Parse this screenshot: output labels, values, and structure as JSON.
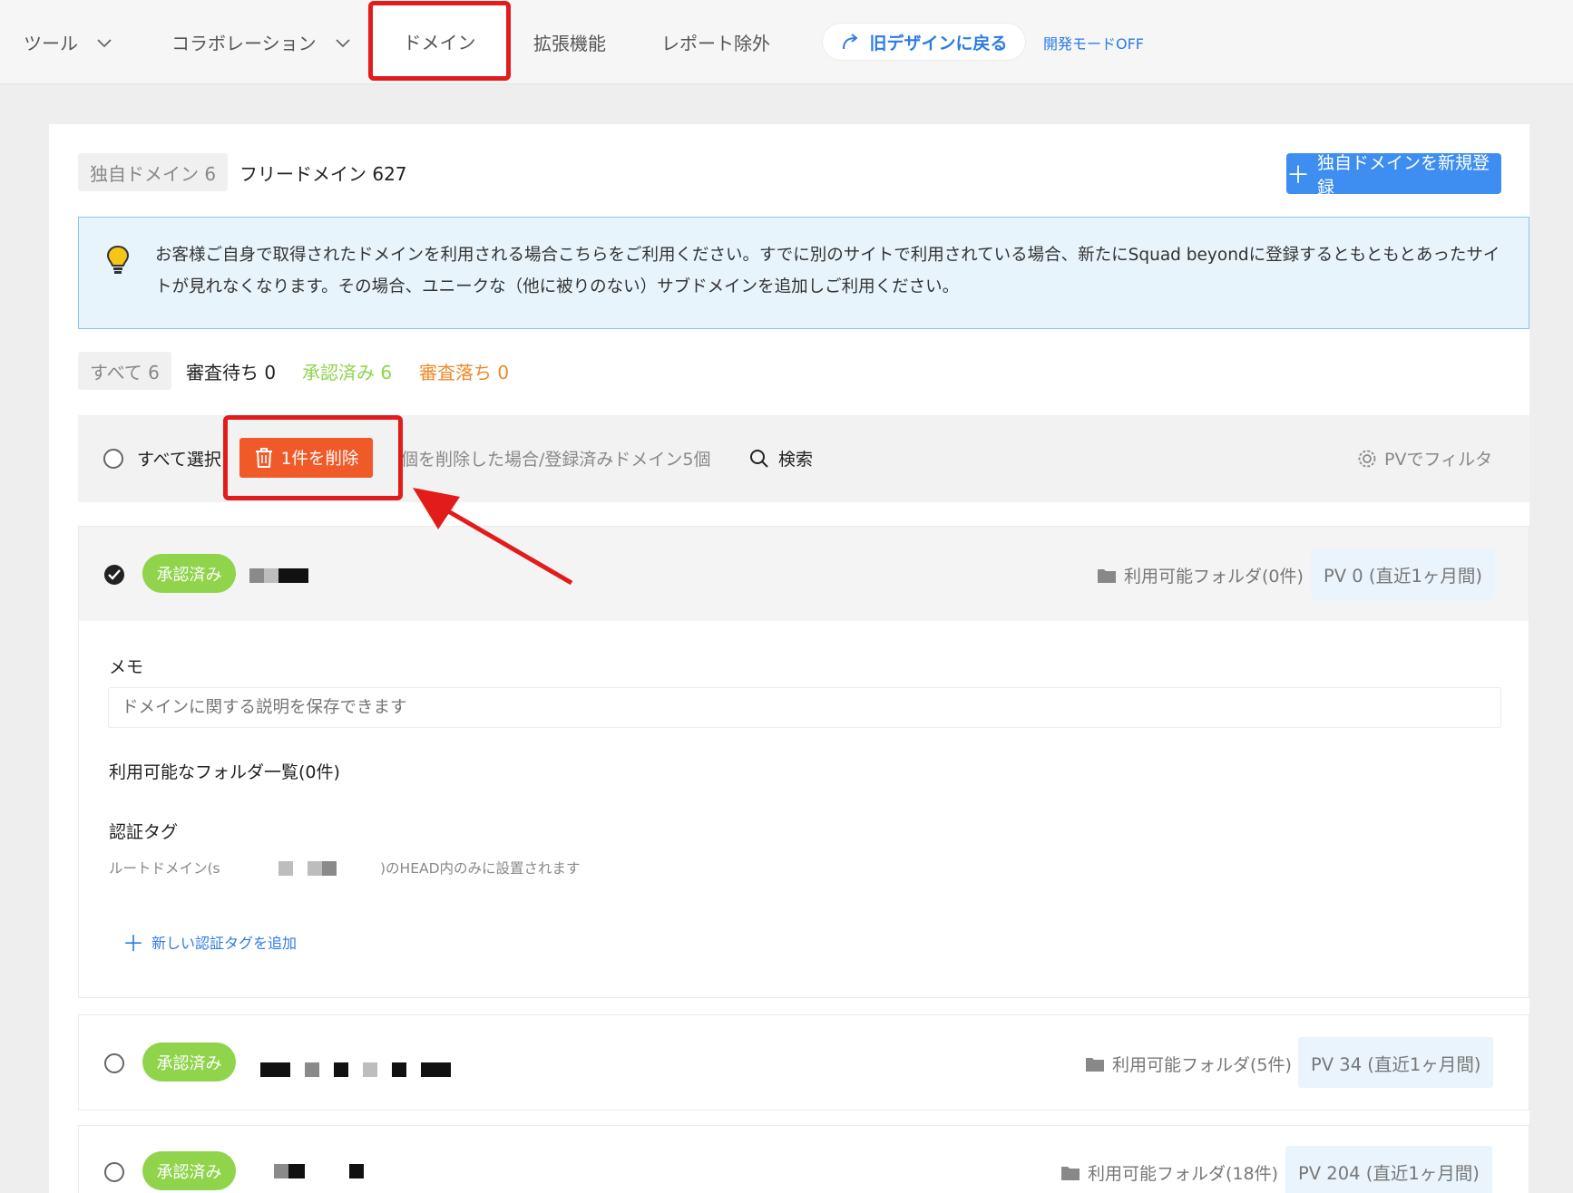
{
  "nav": {
    "tools": "ツール",
    "collab": "コラボレーション",
    "domain": "ドメイン",
    "extensions": "拡張機能",
    "report_exclude": "レポート除外",
    "old_design": "旧デザインに戻る",
    "dev_mode": "開発モードOFF"
  },
  "domain_tabs": {
    "own": "独自ドメイン 6",
    "free": "フリードメイン 627",
    "new_button": "独自ドメインを新規登録"
  },
  "info": {
    "text": "お客様ご自身で取得されたドメインを利用される場合こちらをご利用ください。すでに別のサイトで利用されている場合、新たにSquad beyondに登録するともともとあったサイトが見れなくなります。その場合、ユニークな（他に被りのない）サブドメインを追加しご利用ください。"
  },
  "status_filters": {
    "all": "すべて 6",
    "pending": "審査待ち 0",
    "approved": "承認済み 6",
    "rejected": "審査落ち 0"
  },
  "toolbar": {
    "select_all": "すべて選択",
    "delete": "1件を削除",
    "note": "個を削除した場合/登録済みドメイン5個",
    "search": "検索",
    "pv_filter": "PVでフィルタ"
  },
  "domains": [
    {
      "status": "承認済み",
      "folders": "利用可能フォルダ(0件)",
      "pv": "PV 0 (直近1ヶ月間)",
      "memo_label": "メモ",
      "memo_placeholder": "ドメインに関する説明を保存できます",
      "folder_list_label": "利用可能なフォルダ一覧(0件)",
      "auth_tag_label": "認証タグ",
      "auth_note_prefix": "ルートドメイン(s",
      "auth_note_suffix": ")のHEAD内のみに設置されます",
      "add_tag": "新しい認証タグを追加"
    },
    {
      "status": "承認済み",
      "folders": "利用可能フォルダ(5件)",
      "pv": "PV 34 (直近1ヶ月間)"
    },
    {
      "status": "承認済み",
      "folders": "利用可能フォルダ(18件)",
      "pv": "PV 204 (直近1ヶ月間)"
    }
  ],
  "colors": {
    "accent_blue": "#3d8ef0",
    "delete_orange": "#f05a28",
    "approved_green": "#8fd44a",
    "rejected_orange": "#f0892a",
    "highlight_red": "#e21b1b"
  }
}
